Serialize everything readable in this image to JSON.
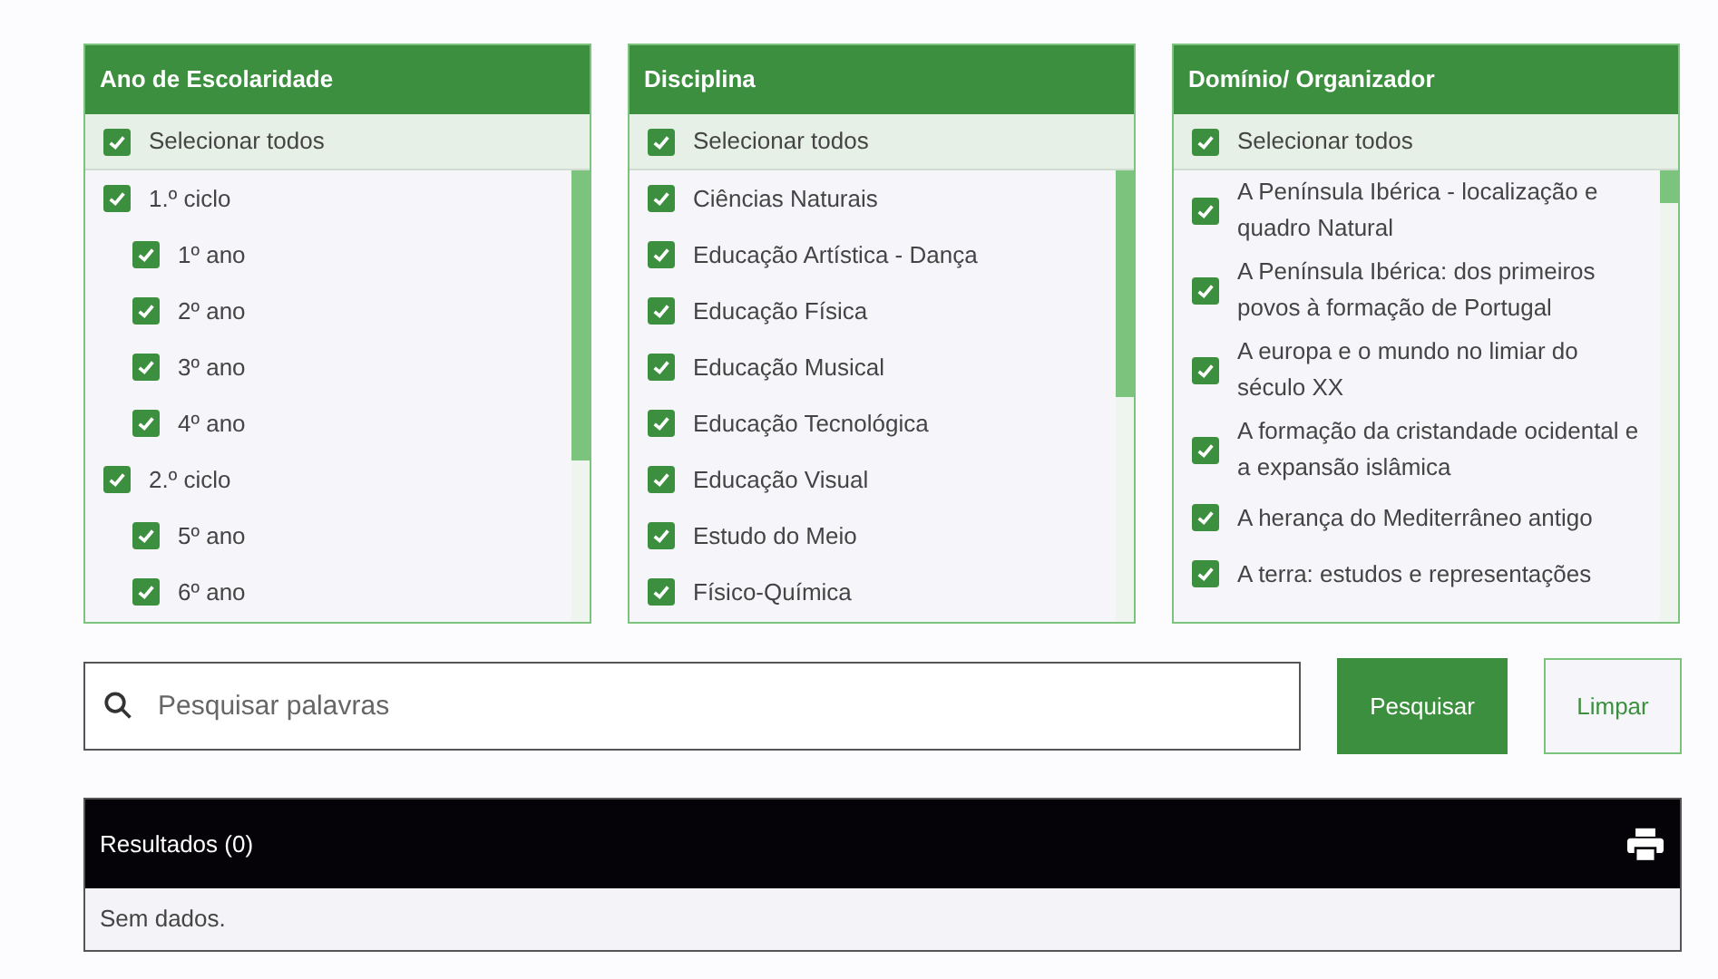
{
  "filters": [
    {
      "title": "Ano de Escolaridade",
      "select_all": {
        "label": "Selecionar todos",
        "checked": true
      },
      "items": [
        {
          "label": "1.º ciclo",
          "checked": true,
          "children": [
            {
              "label": "1º ano",
              "checked": true
            },
            {
              "label": "2º ano",
              "checked": true
            },
            {
              "label": "3º ano",
              "checked": true
            },
            {
              "label": "4º ano",
              "checked": true
            }
          ]
        },
        {
          "label": "2.º ciclo",
          "checked": true,
          "children": [
            {
              "label": "5º ano",
              "checked": true
            },
            {
              "label": "6º ano",
              "checked": true
            }
          ]
        }
      ]
    },
    {
      "title": "Disciplina",
      "select_all": {
        "label": "Selecionar todos",
        "checked": true
      },
      "items": [
        {
          "label": "Ciências Naturais",
          "checked": true
        },
        {
          "label": "Educação Artística - Dança",
          "checked": true
        },
        {
          "label": "Educação Física",
          "checked": true
        },
        {
          "label": "Educação Musical",
          "checked": true
        },
        {
          "label": "Educação Tecnológica",
          "checked": true
        },
        {
          "label": "Educação Visual",
          "checked": true
        },
        {
          "label": "Estudo do Meio",
          "checked": true
        },
        {
          "label": "Físico-Química",
          "checked": true
        }
      ]
    },
    {
      "title": "Domínio/ Organizador",
      "select_all": {
        "label": "Selecionar todos",
        "checked": true
      },
      "items": [
        {
          "label": "A Península Ibérica - localização e quadro Natural",
          "checked": true
        },
        {
          "label": "A Península Ibérica: dos primeiros povos à formação de Portugal",
          "checked": true
        },
        {
          "label": "A europa e o mundo no limiar do século XX",
          "checked": true
        },
        {
          "label": "A formação da cristandade ocidental e a expansão islâmica",
          "checked": true
        },
        {
          "label": "A herança do Mediterrâneo antigo",
          "checked": true
        },
        {
          "label": "A terra: estudos e representações",
          "checked": true
        }
      ]
    }
  ],
  "search": {
    "placeholder": "Pesquisar palavras"
  },
  "buttons": {
    "search": "Pesquisar",
    "clear": "Limpar"
  },
  "results": {
    "title": "Resultados (0)",
    "empty": "Sem dados."
  }
}
